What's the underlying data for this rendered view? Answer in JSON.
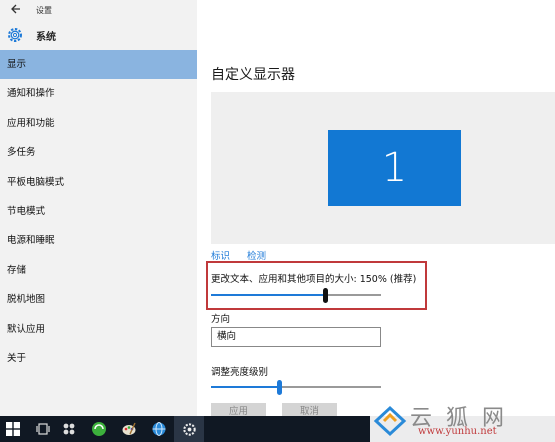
{
  "window": {
    "title": "设置"
  },
  "header": {
    "title": "系统"
  },
  "sidebar": {
    "items": [
      {
        "label": "显示",
        "active": true
      },
      {
        "label": "通知和操作"
      },
      {
        "label": "应用和功能"
      },
      {
        "label": "多任务"
      },
      {
        "label": "平板电脑模式"
      },
      {
        "label": "节电模式"
      },
      {
        "label": "电源和睡眠"
      },
      {
        "label": "存储"
      },
      {
        "label": "脱机地图"
      },
      {
        "label": "默认应用"
      },
      {
        "label": "关于"
      }
    ]
  },
  "main": {
    "title": "自定义显示器",
    "monitor_number": "1",
    "links": {
      "identify": "标识",
      "detect": "检测"
    },
    "scale": {
      "label": "更改文本、应用和其他项目的大小: 150% (推荐)",
      "value_fraction": 0.67
    },
    "orientation": {
      "label": "方向",
      "value": "横向"
    },
    "brightness": {
      "label": "调整亮度级别",
      "value_fraction": 0.4
    },
    "buttons": {
      "apply": "应用",
      "cancel": "取消"
    }
  },
  "watermark": {
    "text": "云狐网",
    "url": "www.yunhu.net"
  },
  "colors": {
    "accent": "#1e7ad8",
    "selected_nav": "#8ab4e0",
    "highlight_box": "#c0393b",
    "monitor": "#1278d3",
    "taskbar": "#101823"
  },
  "taskbar": {
    "icons": [
      "start-icon",
      "task-view-icon",
      "apps-icon",
      "browser-green-icon",
      "paint-icon",
      "network-globe-icon",
      "settings-gear-icon"
    ]
  }
}
